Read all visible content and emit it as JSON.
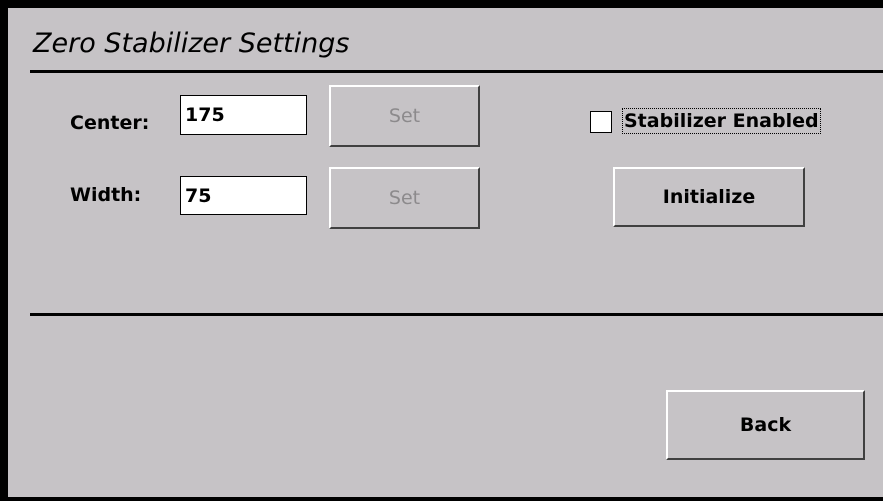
{
  "window": {
    "title": "Zero Stabilizer Settings"
  },
  "center": {
    "label": "Center:",
    "value": "175",
    "set_label": "Set"
  },
  "width": {
    "label": "Width:",
    "value": "75",
    "set_label": "Set"
  },
  "stabilizer": {
    "label": "Stabilizer Enabled",
    "checked": false
  },
  "initialize_label": "Initialize",
  "back_label": "Back",
  "colors": {
    "background": "#c6c3c6",
    "frame": "#000000",
    "disabled_text": "#8c8a8c"
  }
}
